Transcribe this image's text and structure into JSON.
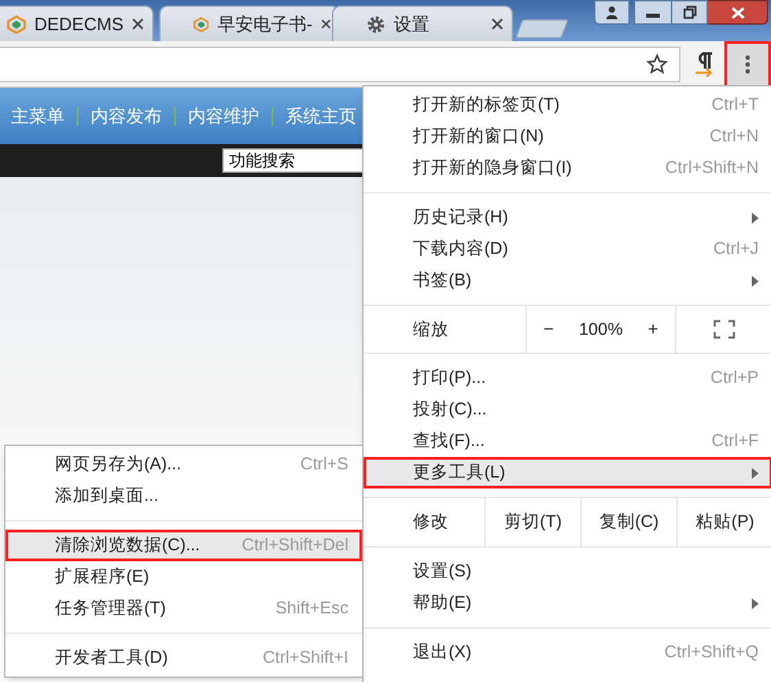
{
  "tabs": [
    {
      "title": "DEDECMS",
      "kind": "site",
      "selected": false
    },
    {
      "title": "早安电子书-",
      "kind": "site",
      "selected": false
    },
    {
      "title": "设置",
      "kind": "settings",
      "selected": false
    }
  ],
  "toolbar": {
    "menu_button_annotated": true
  },
  "page": {
    "nav": [
      "主菜单",
      "内容发布",
      "内容维护",
      "系统主页"
    ],
    "search": {
      "value": "功能搜索"
    }
  },
  "main_menu": [
    {
      "kind": "item",
      "label": "打开新的标签页(T)",
      "shortcut": "Ctrl+T",
      "submenu": false,
      "selected": false,
      "annotated": false
    },
    {
      "kind": "item",
      "label": "打开新的窗口(N)",
      "shortcut": "Ctrl+N",
      "submenu": false,
      "selected": false,
      "annotated": false
    },
    {
      "kind": "item",
      "label": "打开新的隐身窗口(I)",
      "shortcut": "Ctrl+Shift+N",
      "submenu": false,
      "selected": false,
      "annotated": false
    },
    {
      "kind": "separator"
    },
    {
      "kind": "item",
      "label": "历史记录(H)",
      "submenu": true,
      "selected": false,
      "annotated": false
    },
    {
      "kind": "item",
      "label": "下载内容(D)",
      "shortcut": "Ctrl+J",
      "submenu": false,
      "selected": false,
      "annotated": false
    },
    {
      "kind": "item",
      "label": "书签(B)",
      "submenu": true,
      "selected": false,
      "annotated": false
    },
    {
      "kind": "separator"
    },
    {
      "kind": "zoom",
      "label": "缩放",
      "minus": "−",
      "value": "100%",
      "plus": "+"
    },
    {
      "kind": "separator"
    },
    {
      "kind": "item",
      "label": "打印(P)...",
      "shortcut": "Ctrl+P",
      "submenu": false,
      "selected": false,
      "annotated": false
    },
    {
      "kind": "item",
      "label": "投射(C)...",
      "submenu": false,
      "selected": false,
      "annotated": false
    },
    {
      "kind": "item",
      "label": "查找(F)...",
      "shortcut": "Ctrl+F",
      "submenu": false,
      "selected": false,
      "annotated": false
    },
    {
      "kind": "item",
      "label": "更多工具(L)",
      "submenu": true,
      "selected": true,
      "annotated": true
    },
    {
      "kind": "separator"
    },
    {
      "kind": "edit",
      "label": "修改",
      "buttons": [
        "剪切(T)",
        "复制(C)",
        "粘贴(P)"
      ]
    },
    {
      "kind": "separator"
    },
    {
      "kind": "item",
      "label": "设置(S)",
      "submenu": false,
      "selected": false,
      "annotated": false
    },
    {
      "kind": "item",
      "label": "帮助(E)",
      "submenu": true,
      "selected": false,
      "annotated": false
    },
    {
      "kind": "separator"
    },
    {
      "kind": "item",
      "label": "退出(X)",
      "shortcut": "Ctrl+Shift+Q",
      "submenu": false,
      "selected": false,
      "annotated": false
    }
  ],
  "sub_menu": [
    {
      "kind": "item",
      "label": "网页另存为(A)...",
      "shortcut": "Ctrl+S",
      "selected": false,
      "annotated": false
    },
    {
      "kind": "item",
      "label": "添加到桌面...",
      "selected": false,
      "annotated": false
    },
    {
      "kind": "separator"
    },
    {
      "kind": "item",
      "label": "清除浏览数据(C)...",
      "shortcut": "Ctrl+Shift+Del",
      "selected": true,
      "annotated": true
    },
    {
      "kind": "item",
      "label": "扩展程序(E)",
      "selected": false,
      "annotated": false
    },
    {
      "kind": "item",
      "label": "任务管理器(T)",
      "shortcut": "Shift+Esc",
      "selected": false,
      "annotated": false
    },
    {
      "kind": "separator"
    },
    {
      "kind": "item",
      "label": "开发者工具(D)",
      "shortcut": "Ctrl+Shift+I",
      "selected": false,
      "annotated": false
    }
  ]
}
